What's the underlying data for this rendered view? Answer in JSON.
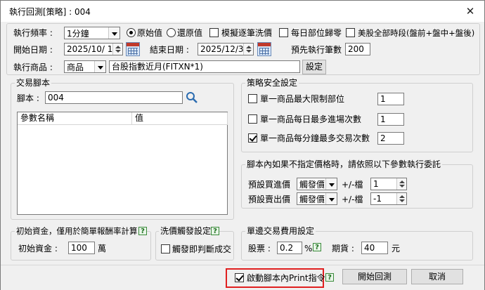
{
  "window": {
    "title": "執行回測[策略] : 004",
    "close_glyph": "✕"
  },
  "settings": {
    "freq_label": "執行頻率 :",
    "freq_value": "1分鐘",
    "radio_original": "原始值",
    "radio_restored": "還原值",
    "chk_simulate": "模擬逐筆洗價",
    "chk_daily_reset": "每日部位歸零",
    "chk_us_all": "美股全部時段(盤前+盤中+盤後)",
    "start_label": "開始日期 :",
    "start_value": "2025/10/ 1",
    "end_label": "結束日期 :",
    "end_value": "2025/12/31",
    "preexec_label": "預先執行筆數",
    "preexec_value": "200",
    "product_label": "執行商品 :",
    "product_type": "商品",
    "product_value": "台股指數近月(FITXN*1)",
    "set_button": "設定"
  },
  "script": {
    "group_title": "交易腳本",
    "script_label": "腳本 :",
    "script_value": "004",
    "col_name": "參數名稱",
    "col_value": "值"
  },
  "strategy": {
    "group_title": "策略安全設定",
    "items": [
      {
        "label": "單一商品最大限制部位",
        "value": "1"
      },
      {
        "label": "單一商品每日最多進場次數",
        "value": "1"
      },
      {
        "label": "單一商品每分鐘最多交易次數",
        "value": "2"
      }
    ]
  },
  "price": {
    "group_title": "腳本內如果不指定價格時，請依照以下參數執行委託",
    "buy_label": "預設買進價",
    "sell_label": "預設賣出價",
    "trigger": "觸發價",
    "tick_label": "+/-檔",
    "buy_tick": "1",
    "sell_tick": "-1"
  },
  "capital": {
    "group_title": "初始資金，僅用於簡單報酬率計算",
    "label": "初始資金 :",
    "value": "100",
    "unit": "萬"
  },
  "wash": {
    "group_title": "洗價觸發設定",
    "chk_label": "觸發即判斷成交"
  },
  "fees": {
    "group_title": "單邊交易費用設定",
    "stock_label": "股票 :",
    "stock_value": "0.2",
    "stock_unit": "%",
    "futures_label": "期貨 :",
    "futures_value": "40",
    "futures_unit": "元"
  },
  "footer": {
    "print_label": "啟動腳本內Print指令",
    "start_button": "開始回測",
    "cancel_button": "取消"
  },
  "help_glyph": "?"
}
